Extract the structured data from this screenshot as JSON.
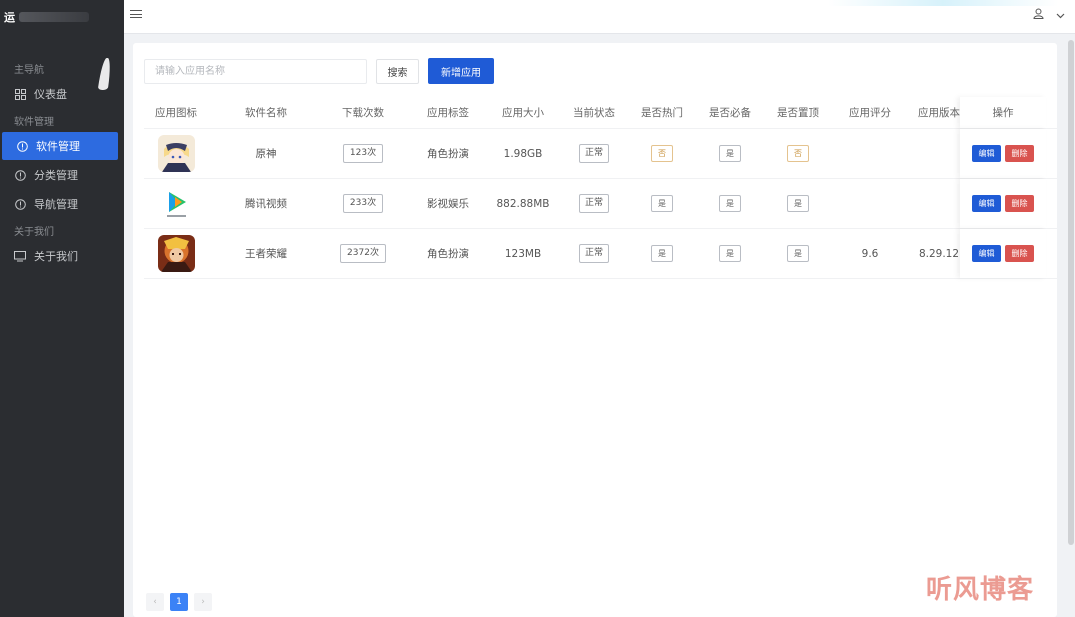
{
  "brand": {
    "title": "运"
  },
  "sidebar": {
    "groups": [
      {
        "label": "主导航"
      },
      {
        "label": "软件管理"
      },
      {
        "label": "关于我们"
      }
    ],
    "items": [
      {
        "label": "仪表盘",
        "icon": "grid-icon"
      },
      {
        "label": "软件管理",
        "icon": "info-circle-icon"
      },
      {
        "label": "分类管理",
        "icon": "info-circle-icon"
      },
      {
        "label": "导航管理",
        "icon": "info-circle-icon"
      },
      {
        "label": "关于我们",
        "icon": "monitor-icon"
      }
    ]
  },
  "toolbar": {
    "search_placeholder": "请输入应用名称",
    "search_label": "搜索",
    "add_label": "新增应用"
  },
  "table": {
    "headers": {
      "icon": "应用图标",
      "name": "软件名称",
      "downloads": "下载次数",
      "tag": "应用标签",
      "size": "应用大小",
      "status": "当前状态",
      "hot": "是否热门",
      "must": "是否必备",
      "top": "是否置顶",
      "score": "应用评分",
      "version": "应用版本",
      "ops": "操作"
    },
    "rows": [
      {
        "name": "原神",
        "downloads": "123次",
        "tag": "角色扮演",
        "size": "1.98GB",
        "status": "正常",
        "hot": "否",
        "must": "是",
        "top": "否",
        "score": "",
        "version": "",
        "icon": "genshin"
      },
      {
        "name": "腾讯视频",
        "downloads": "233次",
        "tag": "影视娱乐",
        "size": "882.88MB",
        "status": "正常",
        "hot": "是",
        "must": "是",
        "top": "是",
        "score": "",
        "version": "",
        "icon": "tencent-video"
      },
      {
        "name": "王者荣耀",
        "downloads": "2372次",
        "tag": "角色扮演",
        "size": "123MB",
        "status": "正常",
        "hot": "是",
        "must": "是",
        "top": "是",
        "score": "9.6",
        "version": "8.29.12",
        "icon": "honor-of-kings"
      }
    ],
    "edit_label": "编辑",
    "delete_label": "删除"
  },
  "pager": {
    "prev": "‹",
    "current": "1",
    "next": "›"
  },
  "watermark": "听风博客",
  "colors": {
    "accent": "#1f5bd6",
    "danger": "#d9534f",
    "sidebar": "#2b2d31"
  }
}
